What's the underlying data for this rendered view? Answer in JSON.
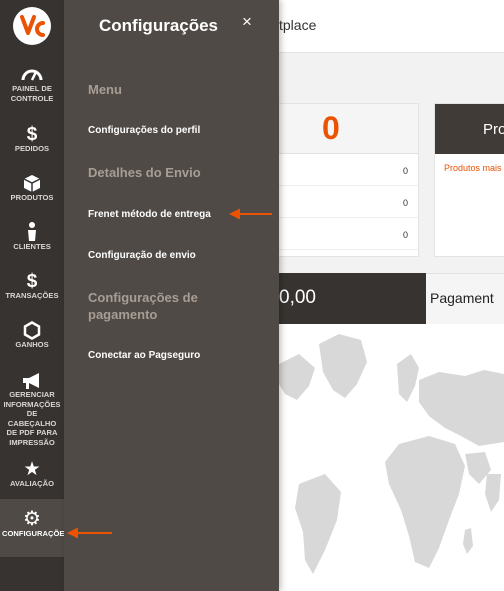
{
  "header": {
    "title_fragment": "tplace"
  },
  "sidebar": {
    "items": [
      {
        "label": "PAINEL DE CONTROLE",
        "icon": "speedometer-icon"
      },
      {
        "label": "PEDIDOS",
        "icon": "dollar-icon"
      },
      {
        "label": "PRODUTOS",
        "icon": "cube-icon"
      },
      {
        "label": "CLIENTES",
        "icon": "person-icon"
      },
      {
        "label": "TRANSAÇÕES",
        "icon": "dollar-icon"
      },
      {
        "label": "GANHOS",
        "icon": "hexagon-icon"
      },
      {
        "label": "GERENCIAR INFORMAÇÕES DE CABEÇALHO DE PDF PARA IMPRESSÃO",
        "icon": "megaphone-icon"
      },
      {
        "label": "AVALIAÇÃO",
        "icon": "star-icon"
      },
      {
        "label": "CONFIGURAÇÕES",
        "icon": "gear-icon",
        "active": true
      }
    ]
  },
  "panel": {
    "title": "Configurações",
    "close_symbol": "×",
    "section_menu": "Menu",
    "link_profile": "Configurações do perfil",
    "section_shipping": "Detalhes do Envio",
    "link_frenet": "Frenet método de entrega",
    "link_shipping_config": "Configuração de envio",
    "section_payment_line1": "Configurações de",
    "section_payment_line2": "pagamento",
    "link_pagseguro": "Conectar ao Pagseguro"
  },
  "dashboard": {
    "big_number": "0",
    "stats": [
      "0",
      "0",
      "0"
    ],
    "card2_title": "Pro",
    "card2_link": "Produtos mais",
    "total_value": "0,00",
    "payments_label": "Pagament"
  },
  "colors": {
    "accent": "#eb5202",
    "rail_bg": "#373330",
    "panel_bg": "#4f4a45",
    "section_text": "#a79d95"
  }
}
